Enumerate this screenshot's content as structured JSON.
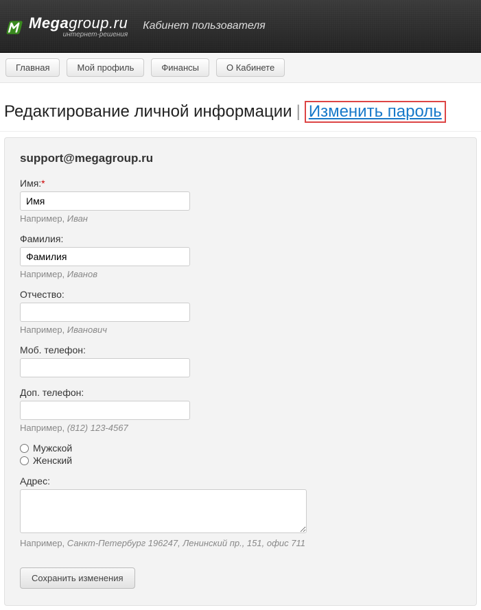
{
  "header": {
    "brand_main": "Mega",
    "brand_rest": "group.ru",
    "tagline": "интернет-решения",
    "cabinet_title": "Кабинет пользователя"
  },
  "nav": {
    "items": [
      {
        "label": "Главная"
      },
      {
        "label": "Мой профиль"
      },
      {
        "label": "Финансы"
      },
      {
        "label": "О Кабинете"
      }
    ]
  },
  "page": {
    "title": "Редактирование личной информации",
    "separator": "|",
    "change_password": "Изменить пароль"
  },
  "form": {
    "email": "support@megagroup.ru",
    "first_name": {
      "label": "Имя:",
      "value": "Имя",
      "hint_prefix": "Например, ",
      "hint_em": "Иван"
    },
    "last_name": {
      "label": "Фамилия:",
      "value": "Фамилия",
      "hint_prefix": "Например, ",
      "hint_em": "Иванов"
    },
    "patronymic": {
      "label": "Отчество:",
      "value": "",
      "hint_prefix": "Например, ",
      "hint_em": "Иванович"
    },
    "mobile": {
      "label": "Моб. телефон:",
      "value": ""
    },
    "extra_phone": {
      "label": "Доп. телефон:",
      "value": "",
      "hint_prefix": "Например, ",
      "hint_em": "(812) 123-4567"
    },
    "gender": {
      "male": "Мужской",
      "female": "Женский"
    },
    "address": {
      "label": "Адрес:",
      "value": "",
      "hint_prefix": "Например, ",
      "hint_em": "Санкт-Петербург 196247, Ленинский пр., 151, офис 711"
    },
    "submit": "Сохранить изменения"
  }
}
